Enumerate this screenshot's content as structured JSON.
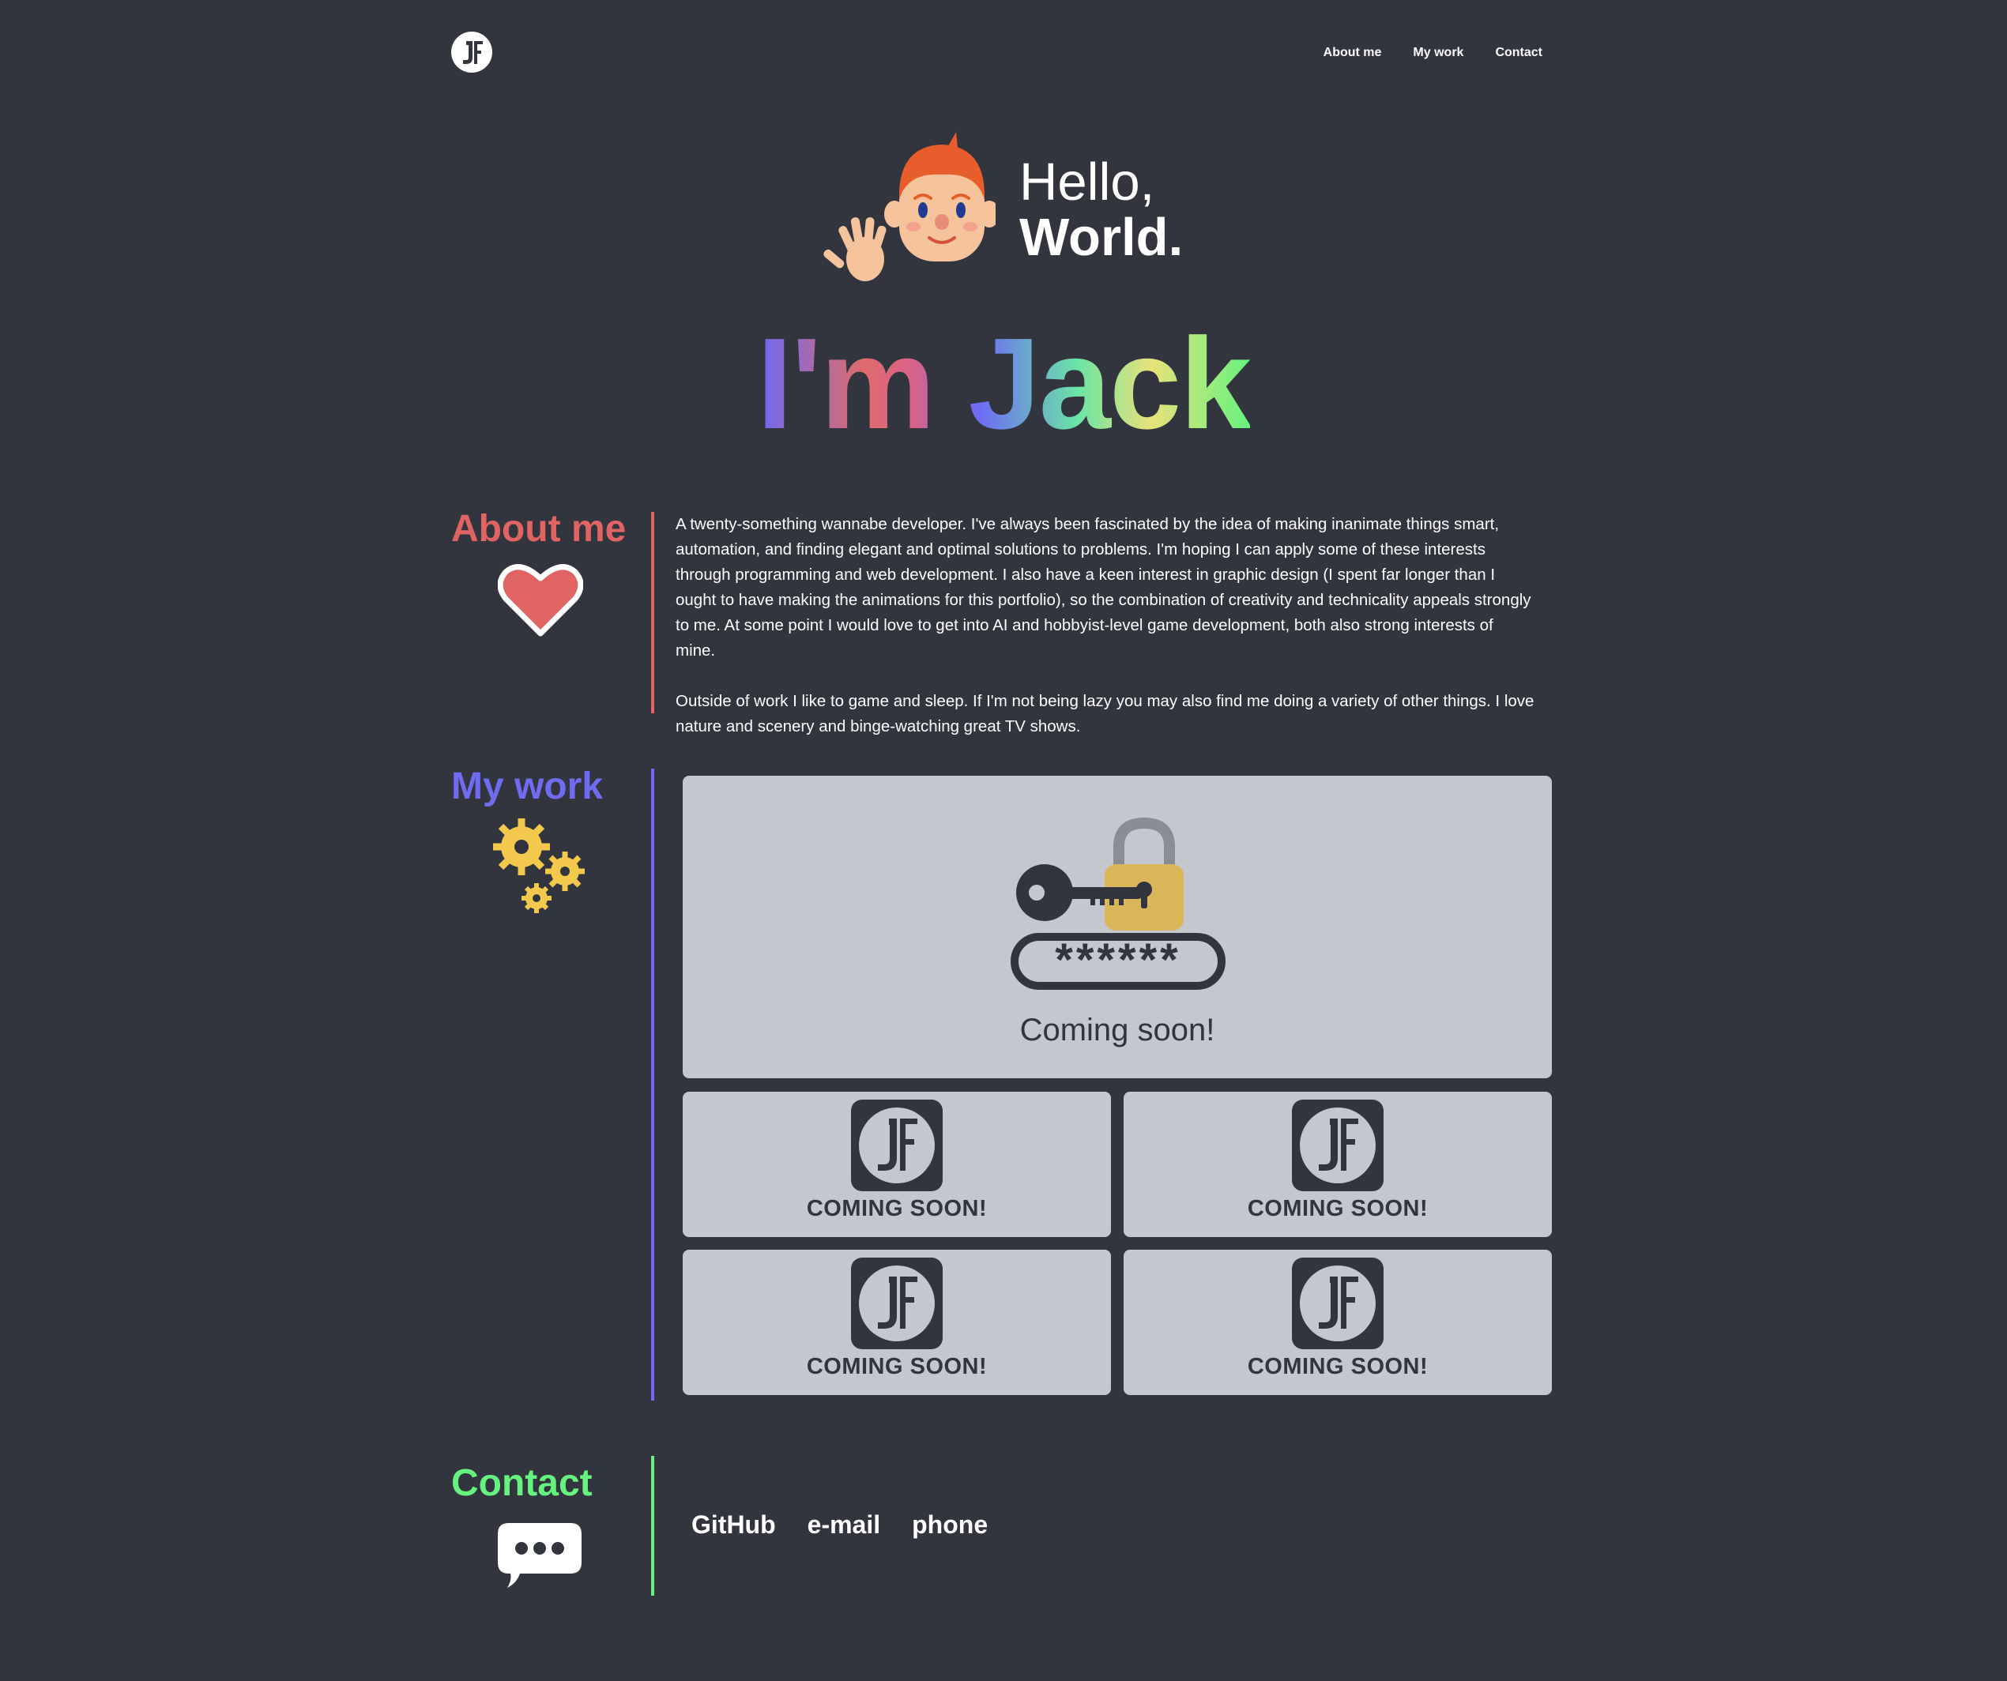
{
  "colors": {
    "background": "#32353e",
    "about_accent": "#e06464",
    "work_accent": "#6f6cf2",
    "contact_accent": "#66f27e",
    "card_background": "#c5c7cf"
  },
  "header": {
    "logo_icon": "jf-monogram-icon",
    "nav": [
      {
        "label": "About me"
      },
      {
        "label": "My work"
      },
      {
        "label": "Contact"
      }
    ]
  },
  "hero": {
    "avatar_icon": "waving-boy-emoji-icon",
    "greeting_line1": "Hello,",
    "greeting_line2": "World.",
    "name": "I'm Jack"
  },
  "about": {
    "title": "About me",
    "icon": "heart-icon",
    "paragraphs": [
      "A twenty-something wannabe developer. I've always been fascinated by the idea of making inanimate things smart, automation, and finding elegant and optimal solutions to problems. I'm hoping I can apply some of these interests through programming and web development. I also have a keen interest in graphic design (I spent far longer than I ought to have making the animations for this portfolio), so the combination of creativity and technicality appeals strongly to me. At some point I would love to get into AI and hobbyist-level game development, both also strong interests of mine.",
      "Outside of work I like to game and sleep. If I'm not being lazy you may also find me doing a variety of other things. I love nature and scenery and binge-watching great TV shows."
    ]
  },
  "work": {
    "title": "My work",
    "icon": "gears-icon",
    "featured": {
      "icon": "key-lock-password-icon",
      "password_mask": "******",
      "label": "Coming soon!"
    },
    "projects": [
      {
        "icon": "jf-monogram-icon",
        "label": "COMING SOON!"
      },
      {
        "icon": "jf-monogram-icon",
        "label": "COMING SOON!"
      },
      {
        "icon": "jf-monogram-icon",
        "label": "COMING SOON!"
      },
      {
        "icon": "jf-monogram-icon",
        "label": "COMING SOON!"
      }
    ]
  },
  "contact": {
    "title": "Contact",
    "icon": "speech-bubble-icon",
    "links": [
      {
        "label": "GitHub"
      },
      {
        "label": "e-mail"
      },
      {
        "label": "phone"
      }
    ]
  }
}
